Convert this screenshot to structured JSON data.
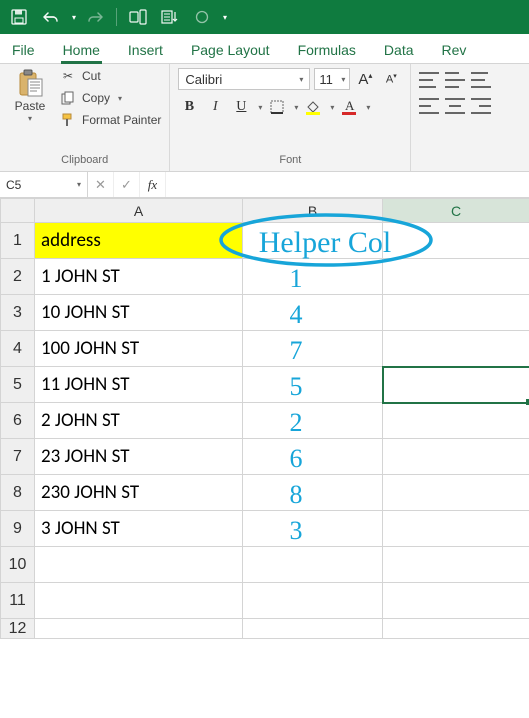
{
  "qat": {
    "save_icon": "save-icon",
    "undo_icon": "undo-icon",
    "redo_icon": "redo-icon",
    "touch_icon": "touch-mode-icon",
    "sort_icon": "sort-icon",
    "circle_icon": "circle-icon"
  },
  "tabs": [
    "File",
    "Home",
    "Insert",
    "Page Layout",
    "Formulas",
    "Data",
    "Rev"
  ],
  "active_tab": "Home",
  "ribbon": {
    "clipboard": {
      "paste": "Paste",
      "cut": "Cut",
      "copy": "Copy",
      "format_painter": "Format Painter",
      "label": "Clipboard"
    },
    "font": {
      "name": "Calibri",
      "size": "11",
      "label": "Font",
      "bold": "B",
      "italic": "I",
      "underline": "U",
      "inc": "A",
      "dec": "A"
    }
  },
  "namebox": "C5",
  "formula": "",
  "columns": [
    "A",
    "B",
    "C"
  ],
  "rows": [
    {
      "n": "1",
      "A": "address",
      "B": "",
      "C": ""
    },
    {
      "n": "2",
      "A": "1 JOHN ST",
      "B": "",
      "C": ""
    },
    {
      "n": "3",
      "A": "10 JOHN ST",
      "B": "",
      "C": ""
    },
    {
      "n": "4",
      "A": "100 JOHN ST",
      "B": "",
      "C": ""
    },
    {
      "n": "5",
      "A": "11 JOHN ST",
      "B": "",
      "C": ""
    },
    {
      "n": "6",
      "A": "2 JOHN ST",
      "B": "",
      "C": ""
    },
    {
      "n": "7",
      "A": "23 JOHN ST",
      "B": "",
      "C": ""
    },
    {
      "n": "8",
      "A": "230 JOHN ST",
      "B": "",
      "C": ""
    },
    {
      "n": "9",
      "A": "3 JOHN ST",
      "B": "",
      "C": ""
    },
    {
      "n": "10",
      "A": "",
      "B": "",
      "C": ""
    },
    {
      "n": "11",
      "A": "",
      "B": "",
      "C": ""
    },
    {
      "n": "12",
      "A": "",
      "B": "",
      "C": ""
    }
  ],
  "selected_cell": "C5",
  "ink": {
    "header": "Helper Col",
    "values": [
      "1",
      "4",
      "7",
      "5",
      "2",
      "6",
      "8",
      "3"
    ]
  }
}
